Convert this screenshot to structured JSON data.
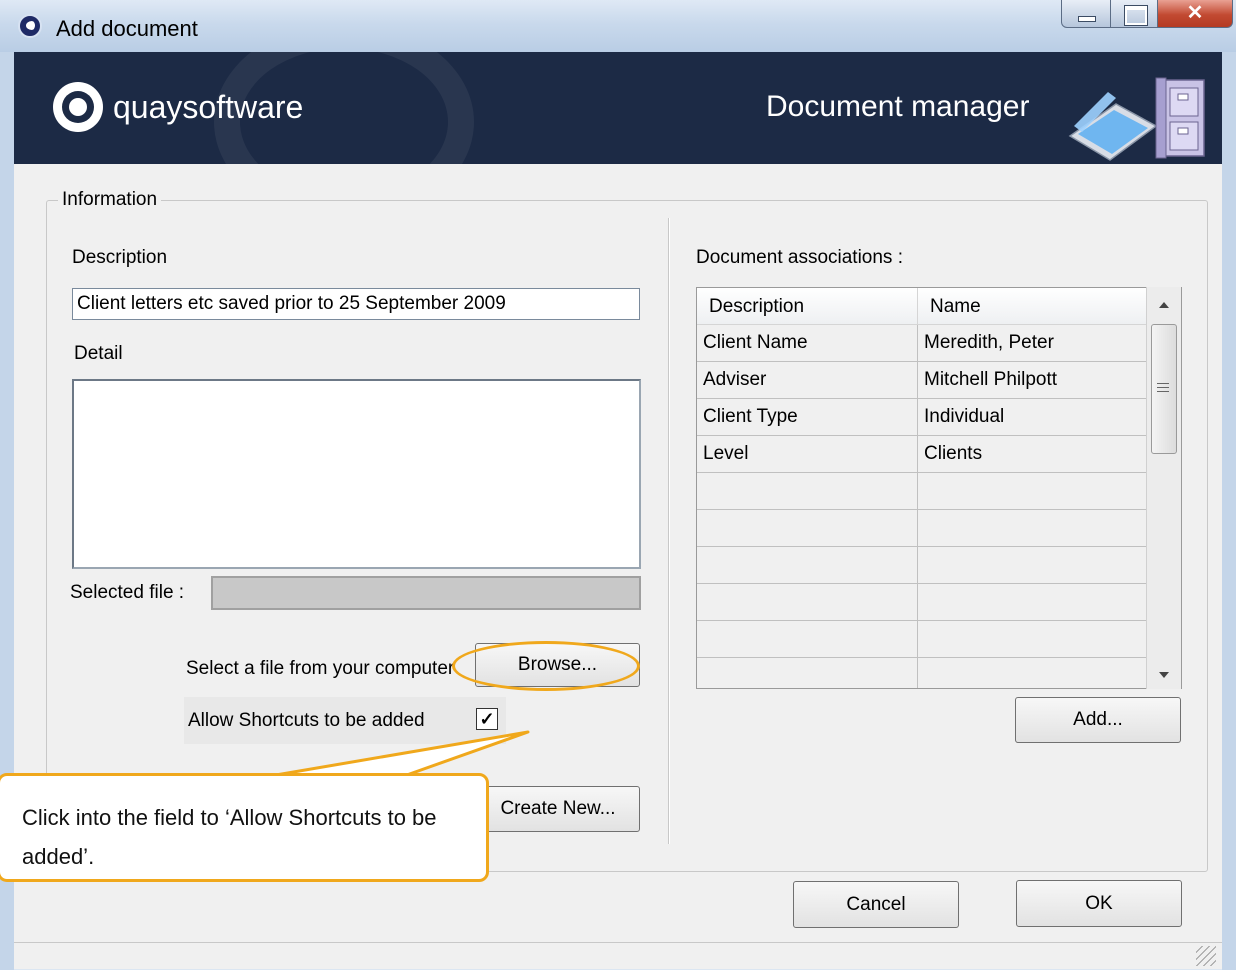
{
  "window": {
    "title": "Add document"
  },
  "banner": {
    "logo_text": "quaysoftware",
    "title": "Document manager"
  },
  "info_group": {
    "label": "Information"
  },
  "form": {
    "description_label": "Description",
    "description_value": "Client letters etc saved prior to 25 September 2009",
    "detail_label": "Detail",
    "detail_value": "",
    "selected_file_label": "Selected file :",
    "selected_file_value": "",
    "select_file_text": "Select a file from your computer",
    "browse_label": "Browse...",
    "allow_shortcuts_label": "Allow Shortcuts to be added",
    "allow_shortcuts_checked": true,
    "create_new_label": "Create New..."
  },
  "associations": {
    "label": "Document associations :",
    "columns": [
      "Description",
      "Name"
    ],
    "rows": [
      [
        "Client Name",
        "Meredith, Peter"
      ],
      [
        "Adviser",
        "Mitchell Philpott"
      ],
      [
        "Client Type",
        "Individual"
      ],
      [
        "Level",
        "Clients"
      ]
    ],
    "empty_rows": 6,
    "add_label": "Add..."
  },
  "footer": {
    "cancel_label": "Cancel",
    "ok_label": "OK"
  },
  "callout": {
    "text": "Click into the field to ‘Allow Shortcuts to be added’."
  },
  "colors": {
    "banner_bg": "#1c2a45",
    "callout_border": "#f0a81c",
    "window_bg": "#f0f0f0"
  },
  "icons": [
    "app-icon",
    "minimize-icon",
    "maximize-icon",
    "close-icon",
    "quaysoftware-logo-icon",
    "scanner-cabinet-icon",
    "checkbox-checked-icon",
    "scroll-up-icon",
    "scroll-down-icon",
    "resize-grip-icon"
  ]
}
